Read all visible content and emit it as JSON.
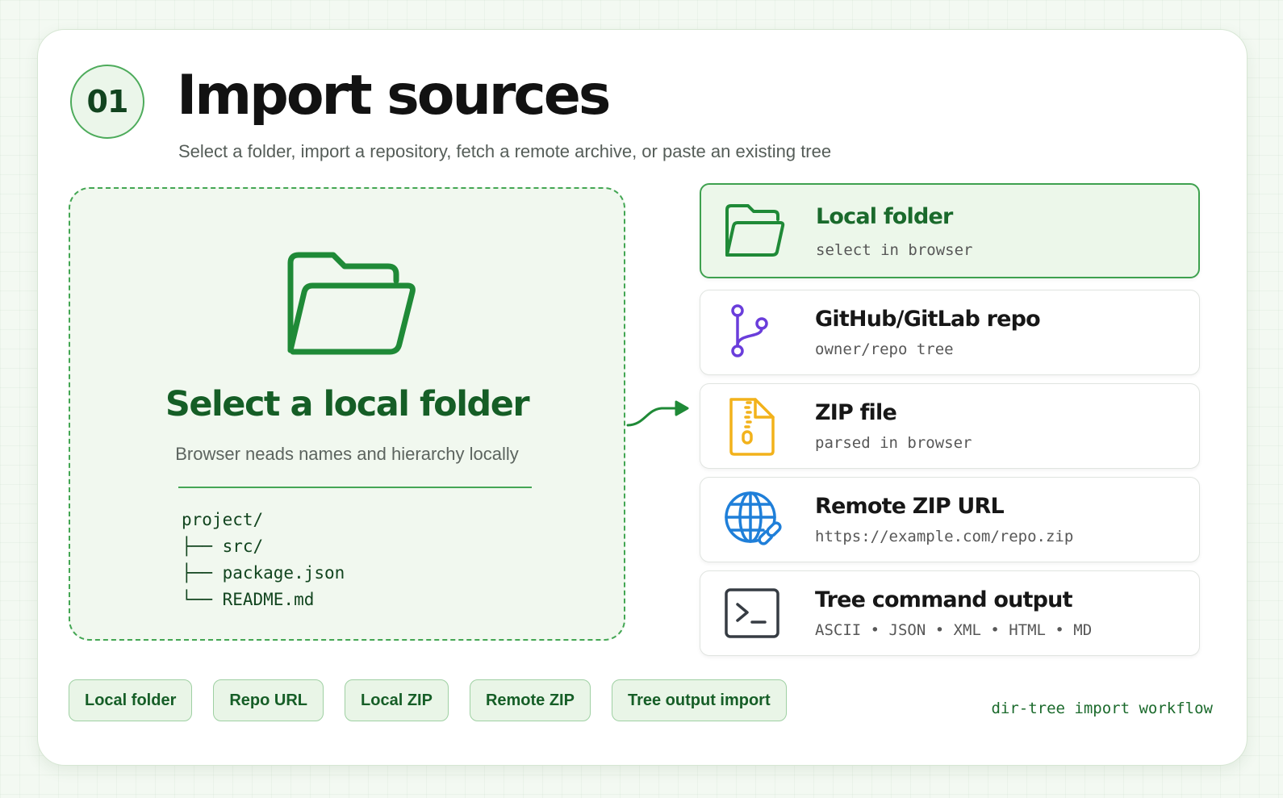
{
  "header": {
    "step_number": "01",
    "title": "Import sources",
    "subtitle": "Select a folder, import a repository, fetch a remote archive, or paste an existing tree"
  },
  "dropzone": {
    "icon": "folder-open-icon",
    "title": "Select a local folder",
    "subtitle": "Browser neads names and hierarchy locally",
    "tree_lines": [
      "project/",
      "├── src/",
      "├── package.json",
      "└── README.md"
    ]
  },
  "sources": [
    {
      "icon": "folder-icon",
      "title": "Local folder",
      "subtitle": "select in browser",
      "active": true
    },
    {
      "icon": "git-branch-icon",
      "title": "GitHub/GitLab repo",
      "subtitle": "owner/repo tree",
      "active": false
    },
    {
      "icon": "zip-file-icon",
      "title": "ZIP file",
      "subtitle": "parsed in browser",
      "active": false
    },
    {
      "icon": "globe-link-icon",
      "title": "Remote ZIP URL",
      "subtitle": "https://example.com/repo.zip",
      "active": false
    },
    {
      "icon": "terminal-icon",
      "title": "Tree command output",
      "subtitle": "ASCII • JSON • XML • HTML • MD",
      "active": false
    }
  ],
  "chips": [
    "Local folder",
    "Repo URL",
    "Local ZIP",
    "Remote ZIP",
    "Tree output import"
  ],
  "footer": "dir-tree import workflow",
  "colors": {
    "accent": "#1f8a37",
    "accent_dark": "#155e26",
    "branch_icon": "#6a3ddb",
    "zip_icon": "#f2b21b",
    "globe_icon": "#1f7fd9",
    "terminal_icon": "#363c43"
  }
}
